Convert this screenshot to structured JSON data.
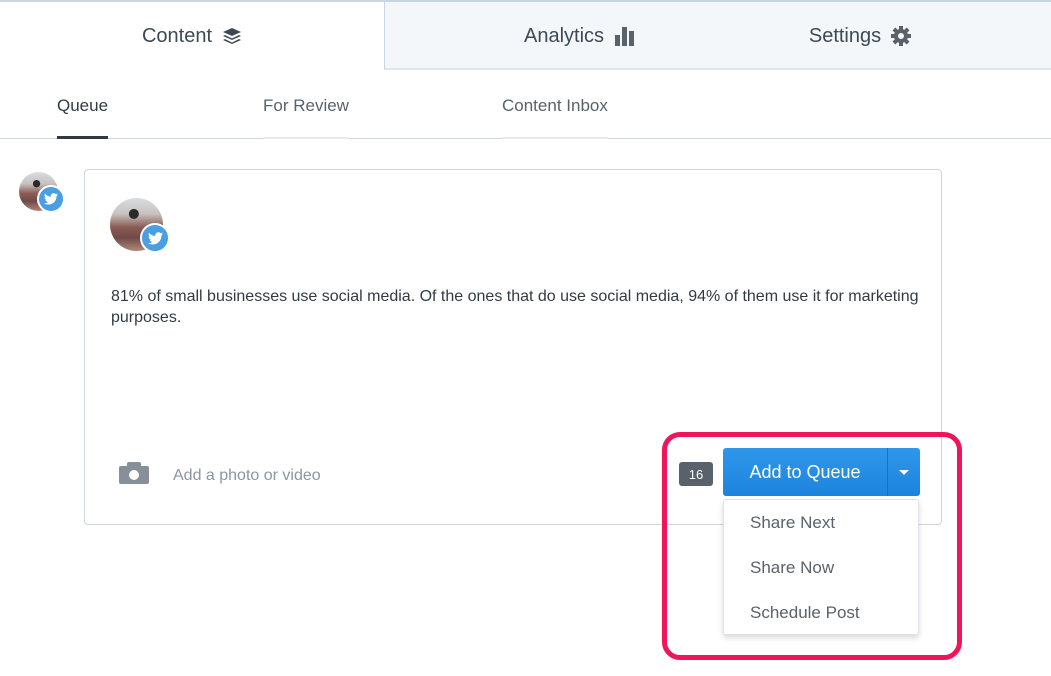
{
  "top_tabs": [
    {
      "label": "Content",
      "icon": "layers-icon",
      "active": true
    },
    {
      "label": "Analytics",
      "icon": "bar-chart-icon",
      "active": false
    },
    {
      "label": "Settings",
      "icon": "gear-icon",
      "active": false
    }
  ],
  "sub_tabs": [
    {
      "label": "Queue",
      "active": true
    },
    {
      "label": "For Review",
      "active": false
    },
    {
      "label": "Content Inbox",
      "active": false
    }
  ],
  "profile": {
    "network": "twitter",
    "badge_color": "#4a9fe2"
  },
  "composer": {
    "text": "81% of small businesses use social media. Of the ones that do use social media, 94% of them use it for marketing purposes.",
    "media_label": "Add a photo or video",
    "char_count": "16",
    "primary_button": "Add to Queue",
    "dropdown_items": [
      "Share Next",
      "Share Now",
      "Schedule Post"
    ]
  },
  "colors": {
    "accent": "#1d84de",
    "highlight": "#f0145a"
  }
}
